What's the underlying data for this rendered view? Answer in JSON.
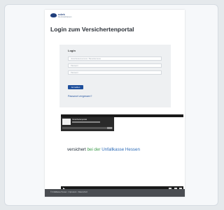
{
  "header": {
    "logo_text": "vdek",
    "logo_sub": "Die Ersatzkassen"
  },
  "page_title": "Login zum Versichertenportal",
  "login": {
    "heading": "Login",
    "field1_placeholder": "Versichertennummer / Benutzername",
    "field2_placeholder": "Passwort",
    "field3_placeholder": "Passwort",
    "button_label": "Anmelden",
    "forgot_link": "Passwort vergessen?"
  },
  "video": {
    "overlay_title": "Versichertenportal",
    "slogan_part1": "versichert",
    "slogan_part2": "bei der",
    "slogan_part3": "Unfallkasse Hessen"
  },
  "footer": {
    "text": "© Unfallkasse Hessen · Impressum · Datenschutz"
  },
  "colors": {
    "accent": "#1e4f9c",
    "slogan_green": "#3b9a4a",
    "slogan_blue": "#2e6cb8",
    "footer_bg": "#4a4d52"
  }
}
